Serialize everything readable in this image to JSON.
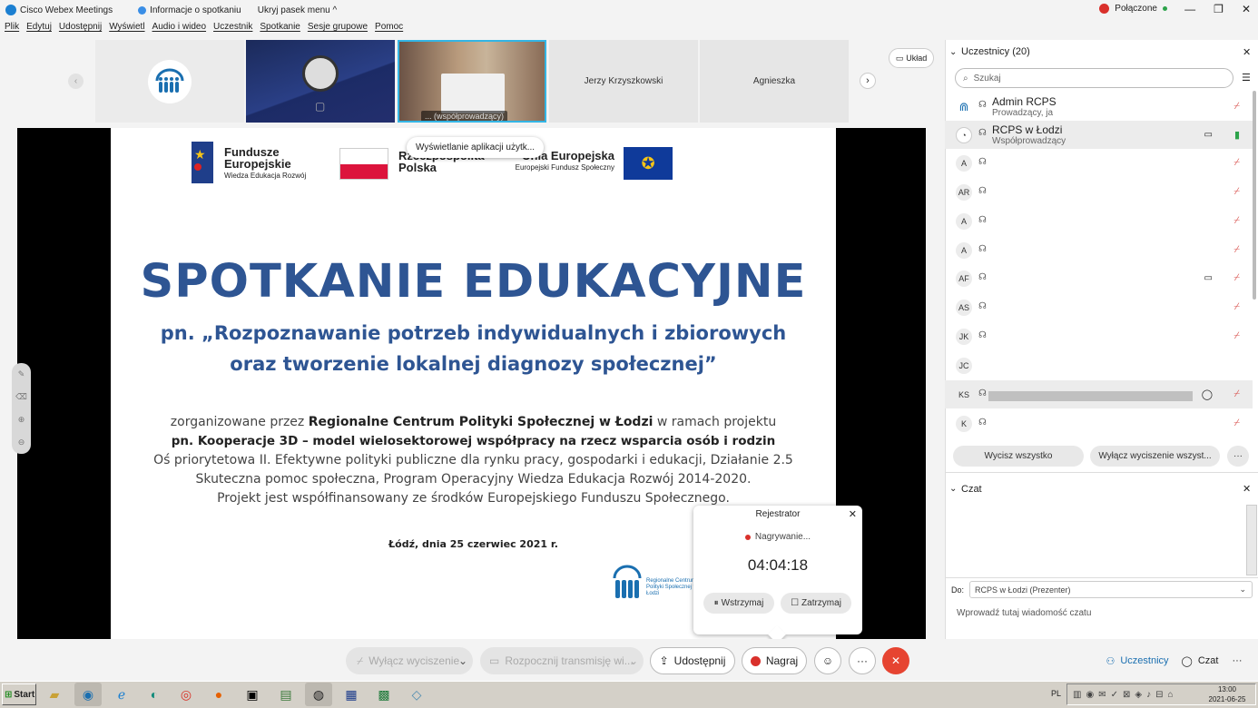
{
  "titlebar": {
    "app": "Cisco Webex Meetings",
    "info": "Informacje o spotkaniu",
    "hide": "Ukryj pasek menu ^",
    "status": "Połączone",
    "min": "—",
    "max": "❐",
    "close": "✕"
  },
  "menu": [
    "Plik",
    "Edytuj",
    "Udostępnij",
    "Wyświetl",
    "Audio i wideo",
    "Uczestnik",
    "Spotkanie",
    "Sesje grupowe",
    "Pomoc"
  ],
  "thumbs": {
    "video_label": "... (współprowadzący)",
    "name4": "Jerzy Krzyszkowski",
    "name5": "Agnieszka",
    "layout": "Układ"
  },
  "tooltip": "Wyświetlanie aplikacji użytk...",
  "slide": {
    "fe_line1": "Fundusze",
    "fe_line2": "Europejskie",
    "fe_line3": "Wiedza Edukacja Rozwój",
    "rp_line1": "Rzeczpospolita",
    "rp_line2": "Polska",
    "ue_line1": "Unia Europejska",
    "ue_line2": "Europejski Fundusz Społeczny",
    "title": "SPOTKANIE EDUKACYJNE",
    "subtitle1": "pn. „Rozpoznawanie potrzeb indywidualnych i zbiorowych",
    "subtitle2": "oraz tworzenie lokalnej diagnozy społecznej”",
    "b1a": "zorganizowane przez ",
    "b1b": "Regionalne Centrum Polityki Społecznej w Łodzi",
    "b1c": " w ramach projektu",
    "b2": "pn. Kooperacje 3D – model wielosektorowej współpracy na rzecz wsparcia osób i rodzin",
    "b3": "Oś priorytetowa II. Efektywne polityki publiczne dla rynku pracy, gospodarki i edukacji, Działanie 2.5",
    "b4": "Skuteczna pomoc społeczna, Program Operacyjny Wiedza Edukacja Rozwój 2014-2020.",
    "b5": "Projekt jest współfinansowany ze środków Europejskiego Funduszu Społecznego.",
    "date": "Łódź, dnia 25 czerwiec 2021 r.",
    "logo_text": "Regionalne Centrum Polityki Społecznej w Łodzi"
  },
  "participants": {
    "header": "Uczestnicy (20)",
    "search_placeholder": "Szukaj",
    "list": [
      {
        "initials": "",
        "name": "Admin RCPS",
        "role": "Prowadzący, ja"
      },
      {
        "initials": "",
        "name": "RCPS w Łodzi",
        "role": "Współprowadzący"
      },
      {
        "initials": "A",
        "name": "",
        "role": ""
      },
      {
        "initials": "AR",
        "name": "",
        "role": ""
      },
      {
        "initials": "A",
        "name": "",
        "role": ""
      },
      {
        "initials": "A",
        "name": "",
        "role": ""
      },
      {
        "initials": "AF",
        "name": "",
        "role": ""
      },
      {
        "initials": "AS",
        "name": "",
        "role": ""
      },
      {
        "initials": "JK",
        "name": "",
        "role": ""
      },
      {
        "initials": "JC",
        "name": "",
        "role": ""
      },
      {
        "initials": "KS",
        "name": "",
        "role": ""
      },
      {
        "initials": "K",
        "name": "",
        "role": ""
      }
    ],
    "mute_all": "Wycisz wszystko",
    "unmute_all": "Wyłącz wyciszenie wszyst...",
    "more": "···"
  },
  "chat": {
    "header": "Czat",
    "to_label": "Do:",
    "to_value": "RCPS w Łodzi (Prezenter)",
    "placeholder": "Wprowadź tutaj wiadomość czatu"
  },
  "recorder": {
    "title": "Rejestrator",
    "status": "Nagrywanie...",
    "time": "04:04:18",
    "pause": "Wstrzymaj",
    "stop": "Zatrzymaj"
  },
  "bottom": {
    "unmute": "Wyłącz wyciszenie",
    "stream": "Rozpocznij transmisję wi...",
    "share": "Udostępnij",
    "record": "Nagraj",
    "participants": "Uczestnicy",
    "chat": "Czat",
    "more": "···"
  },
  "taskbar": {
    "start": "Start",
    "lang": "PL",
    "time": "13:00",
    "date": "2021-06-25"
  },
  "colors": {
    "accent": "#2e5593",
    "end_call": "#e64431",
    "record_dot": "#d9302b",
    "muted": "#d9534f",
    "active_mic": "#2ca34a"
  }
}
